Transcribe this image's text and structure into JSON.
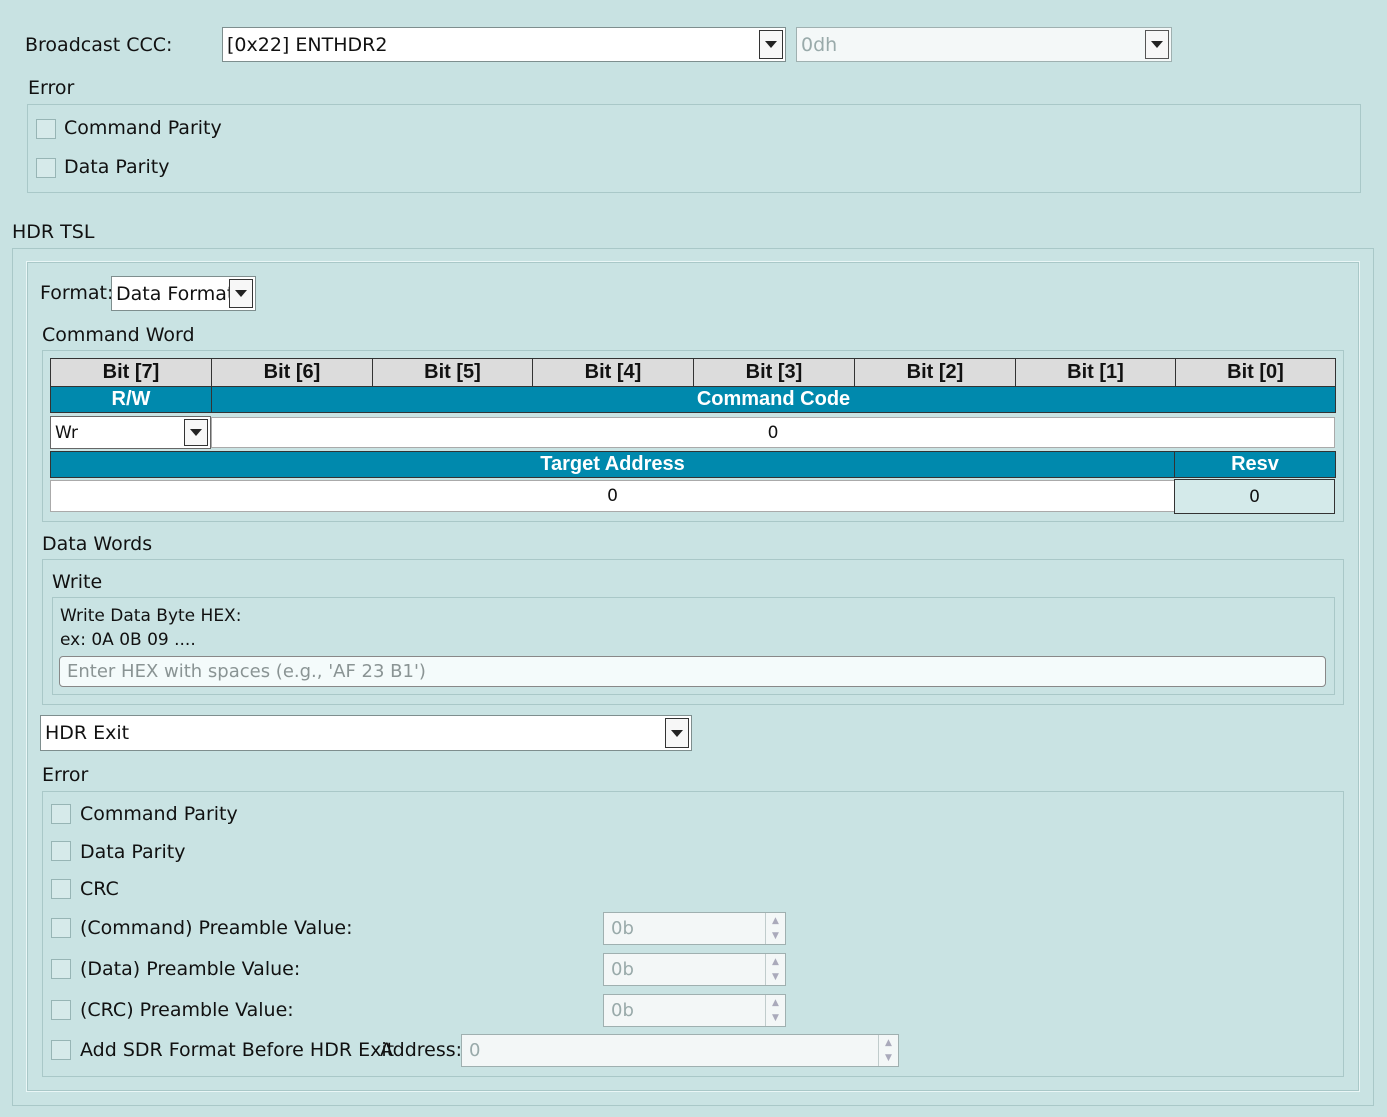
{
  "broadcast": {
    "label": "Broadcast CCC:",
    "ccc_value": "[0x22] ENTHDR2",
    "code_value": "0dh"
  },
  "top_error": {
    "title": "Error",
    "items": [
      "Command Parity",
      "Data Parity"
    ]
  },
  "hdr_tsl": {
    "title": "HDR TSL",
    "format_label": "Format:",
    "format_value": "Data Format",
    "command_word_title": "Command Word",
    "bit_headers": [
      "Bit [7]",
      "Bit [6]",
      "Bit [5]",
      "Bit [4]",
      "Bit [3]",
      "Bit [2]",
      "Bit [1]",
      "Bit [0]"
    ],
    "rw_label": "R/W",
    "command_code_label": "Command Code",
    "rw_value": "Wr",
    "command_code_value": "0",
    "target_address_label": "Target Address",
    "resv_label": "Resv",
    "target_address_value": "0",
    "resv_value": "0",
    "data_words_title": "Data Words",
    "write_title": "Write",
    "write_desc_line1": "Write Data Byte HEX:",
    "write_desc_line2": "ex: 0A 0B 09 ....",
    "hex_placeholder": "Enter HEX with spaces (e.g., 'AF 23 B1')",
    "exit_value": "HDR Exit",
    "error_title": "Error",
    "error_items": [
      "Command Parity",
      "Data Parity",
      "CRC"
    ],
    "preamble_items": [
      {
        "label": "(Command) Preamble Value:",
        "value": "0b"
      },
      {
        "label": "(Data) Preamble Value:",
        "value": "0b"
      },
      {
        "label": "(CRC) Preamble Value:",
        "value": "0b"
      }
    ],
    "sdr_label": "Add SDR Format Before HDR Exit",
    "address_label": "Address:",
    "address_value": "0"
  }
}
